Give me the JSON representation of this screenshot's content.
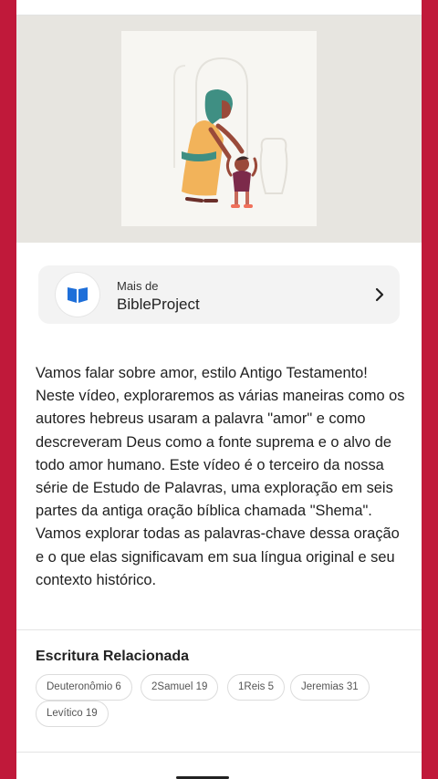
{
  "publisher": {
    "prefix": "Mais de",
    "name": "BibleProject"
  },
  "description": "Vamos falar sobre amor, estilo Antigo Testamento! Neste vídeo, exploraremos as várias maneiras como os autores hebreus usaram a palavra \"amor\" e como descreveram Deus como a fonte suprema e o alvo de todo amor humano. Este vídeo é o terceiro da nossa série de Estudo de Palavras, uma exploração em seis partes da antiga oração bíblica chamada \"Shema\". Vamos explorar todas as palavras-chave dessa oração e o que elas significavam em sua língua original e seu contexto histórico.",
  "related": {
    "title": "Escritura Relacionada",
    "chips": [
      "Deuteronômio 6",
      "2Samuel 19",
      "1Reis 5",
      "Jeremias 31",
      "Levítico 19"
    ]
  },
  "colors": {
    "frame": "#c0193a",
    "logo_blue": "#1e6fd9"
  }
}
